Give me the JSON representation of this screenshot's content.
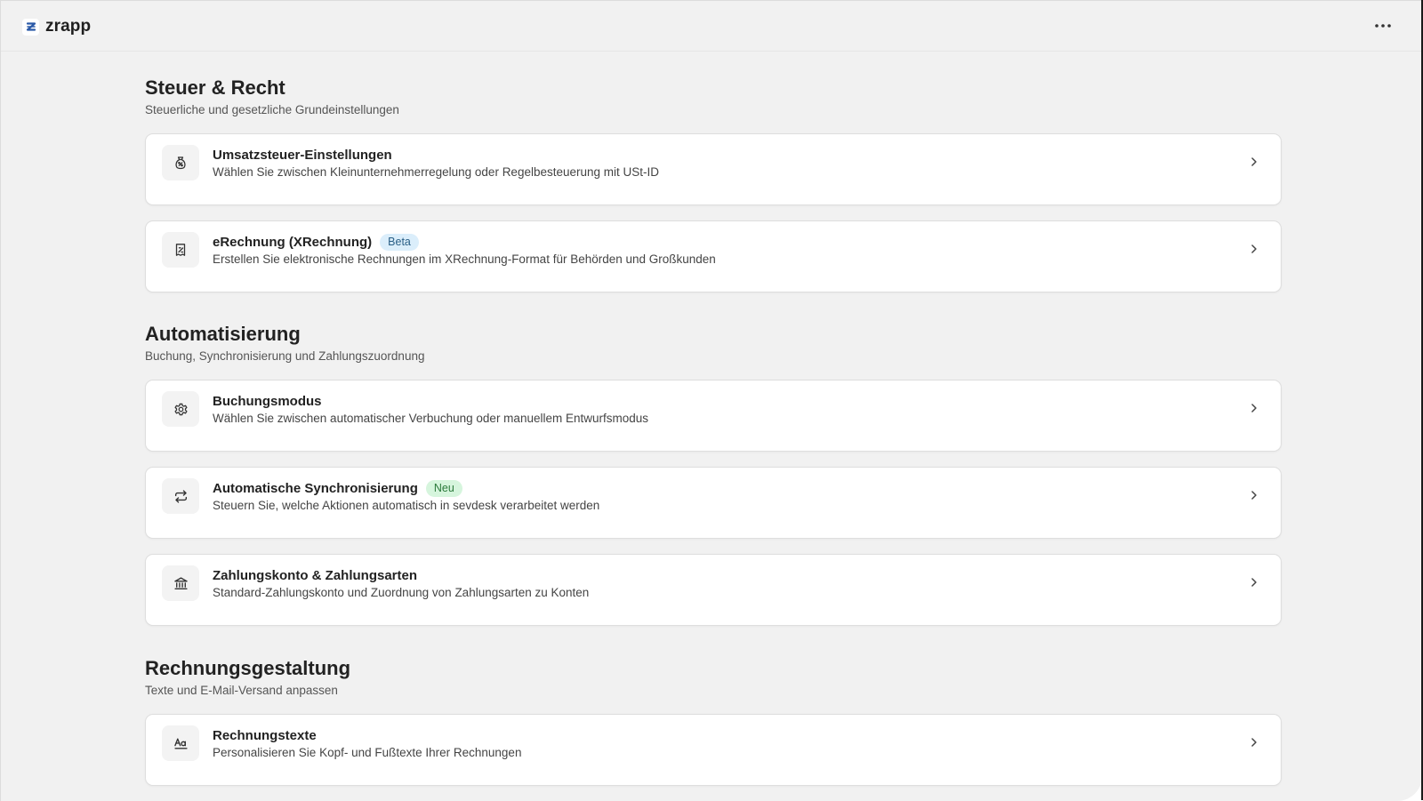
{
  "app": {
    "name": "zrapp",
    "more_icon": "more-horizontal-icon"
  },
  "sections": [
    {
      "title": "Steuer & Recht",
      "subtitle": "Steuerliche und gesetzliche Grundeinstellungen",
      "items": [
        {
          "icon": "money-bag-icon",
          "title": "Umsatzsteuer-Einstellungen",
          "badge": "",
          "description": "Wählen Sie zwischen Kleinunternehmerregelung oder Regelbesteuerung mit USt-ID"
        },
        {
          "icon": "receipt-icon",
          "title": "eRechnung (XRechnung)",
          "badge": "Beta",
          "description": "Erstellen Sie elektronische Rechnungen im XRechnung-Format für Behörden und Großkunden"
        }
      ]
    },
    {
      "title": "Automatisierung",
      "subtitle": "Buchung, Synchronisierung und Zahlungszuordnung",
      "items": [
        {
          "icon": "gear-icon",
          "title": "Buchungsmodus",
          "badge": "",
          "description": "Wählen Sie zwischen automatischer Verbuchung oder manuellem Entwurfsmodus"
        },
        {
          "icon": "sync-arrows-icon",
          "title": "Automatische Synchronisierung",
          "badge": "Neu",
          "description": "Steuern Sie, welche Aktionen automatisch in sevdesk verarbeitet werden"
        },
        {
          "icon": "bank-icon",
          "title": "Zahlungskonto & Zahlungsarten",
          "badge": "",
          "description": "Standard-Zahlungskonto und Zuordnung von Zahlungsarten zu Konten"
        }
      ]
    },
    {
      "title": "Rechnungsgestaltung",
      "subtitle": "Texte und E-Mail-Versand anpassen",
      "items": [
        {
          "icon": "text-format-icon",
          "title": "Rechnungstexte",
          "badge": "",
          "description": "Personalisieren Sie Kopf- und Fußtexte Ihrer Rechnungen"
        }
      ]
    }
  ],
  "colors": {
    "background": "#f1f1f1",
    "card": "#ffffff",
    "badge_beta_bg": "#dbeefb",
    "badge_neu_bg": "#d6f5dd",
    "logo_accent": "#2b5aa8"
  }
}
